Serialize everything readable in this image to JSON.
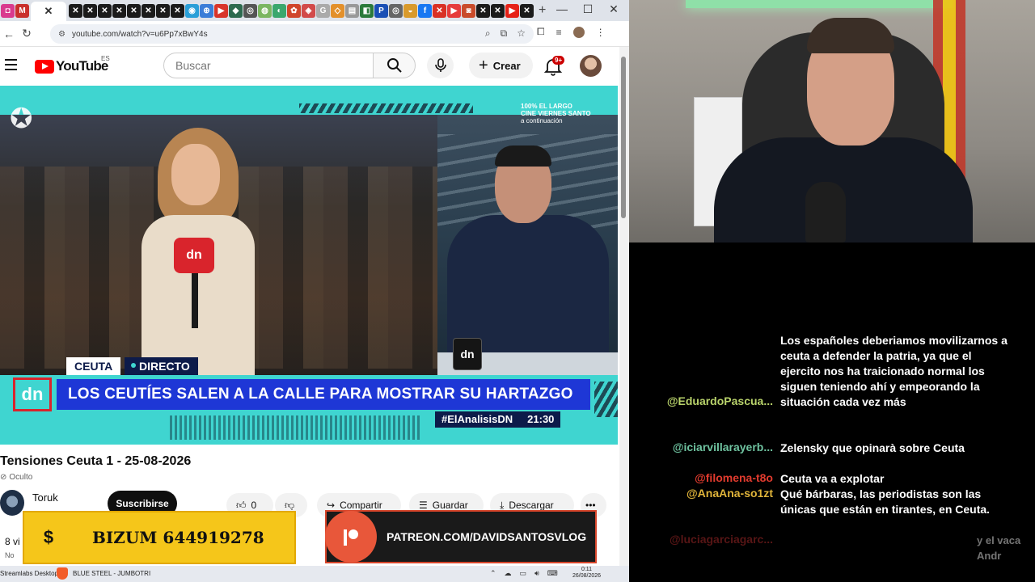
{
  "browser": {
    "url": "youtube.com/watch?v=u6Pp7xBwY4s",
    "new_tab": "+",
    "window_controls": {
      "minimize": "—",
      "maximize": "☐",
      "close": "✕"
    }
  },
  "youtube": {
    "logo_text": "YouTube",
    "country": "ES",
    "search_placeholder": "Buscar",
    "create_label": "Crear",
    "notifications_badge": "9+"
  },
  "video": {
    "broadcast": {
      "cine_line1": "100%",
      "cine_line2": "EL LARGO",
      "cine_line3": "CINE VIERNES SANTO",
      "cine_line4": "a continuación",
      "location_tag": "CEUTA",
      "live_tag": "DIRECTO",
      "headline": "LOS CEUTÍES SALEN A LA CALLE PARA MOSTRAR SU HARTAZGO",
      "hashtag": "#ElAnalisisDN",
      "time": "21:30",
      "logo": "dn",
      "mic_logo": "dn",
      "mug_logo": "dn"
    },
    "title": "Tensiones Ceuta 1 - 25-08-2026",
    "visibility": "Oculto",
    "channel": "Toruk",
    "subscribe_label": "Suscribirse",
    "likes": "0",
    "share_label": "Compartir",
    "save_label": "Guardar",
    "download_label": "Descargar",
    "more_label": "•••",
    "views": "8 vi",
    "views_sub": "No"
  },
  "overlays": {
    "bizum_symbol": "$",
    "bizum_text": "BIZUM 644919278",
    "patreon_text": "PATREON.COM/DAVIDSANTOSVLOG"
  },
  "taskbar": {
    "app1": "Streamlabs Desktop",
    "app2": "BLUE STEEL - JUMBOTRI",
    "time": "0:11",
    "date": "26/08/2026"
  },
  "chat": {
    "messages": [
      {
        "user": "",
        "color": "#2c3bd6",
        "text": "Los españoles deberiamos movilizarnos a ceuta a defender la patria, ya que el ejercito nos ha traicionado normal los siguen teniendo ahí y empeorando la situación cada vez más"
      },
      {
        "user": "@EduardoPascua...",
        "color": "#b9d36b",
        "text": ""
      },
      {
        "user": "@iciarvillarayerb...",
        "color": "#6fc3a0",
        "text": "Zelensky que opinarà sobre Ceuta"
      },
      {
        "user": "@filomena-t8o",
        "color": "#e23b2e",
        "text": "Ceuta va a explotar"
      },
      {
        "user": "@AnaAna-so1zt",
        "color": "#e0b43a",
        "text": "Qué bárbaras, las periodistas son las únicas que están en tirantes, en Ceuta."
      },
      {
        "user": "@luciagarciagarc...",
        "color": "#c03030",
        "text": "y el vaca Andr"
      }
    ]
  }
}
